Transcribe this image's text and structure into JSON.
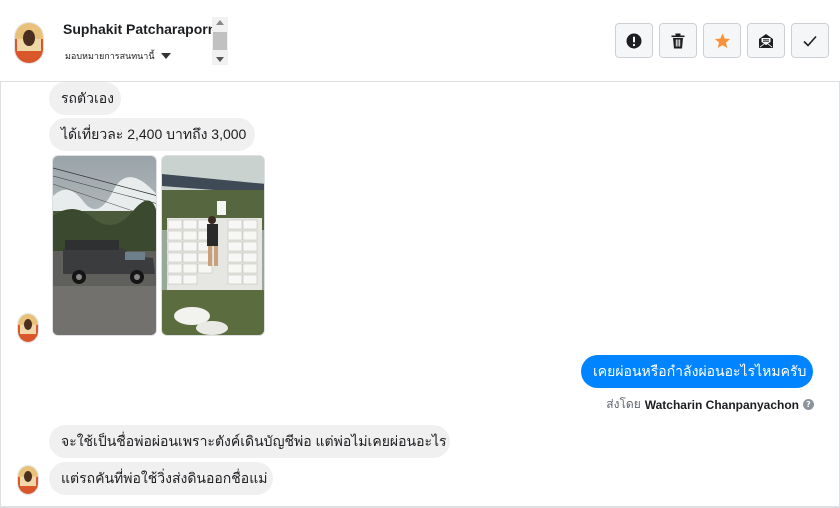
{
  "header": {
    "contact_name": "Suphakit Patcharaporn",
    "assign_label": "มอบหมายการสนทนานี้",
    "actions": [
      {
        "name": "report-spam-button",
        "icon": "exclamation-circle-icon"
      },
      {
        "name": "delete-button",
        "icon": "trash-icon"
      },
      {
        "name": "star-button",
        "icon": "star-icon",
        "color": "#f7923b"
      },
      {
        "name": "mark-unread-button",
        "icon": "envelope-icon"
      },
      {
        "name": "mark-done-button",
        "icon": "checkmark-icon"
      }
    ]
  },
  "messages": {
    "m1": "รถตัวเอง",
    "m2": "ได้เที่ยวละ 2,400 บาทถึง 3,000",
    "m3": "เคยผ่อนหรือกำลังผ่อนอะไรไหมครับ",
    "m4": "จะใช้เป็นชื่อพ่อผ่อนเพราะตังค์เดินบัญชีพ่อ แต่พ่อไม่เคยผ่อนอะไร",
    "m5": "แต่รถคันที่พ่อใช้วิ่งส่งดินออกชื่อแม่"
  },
  "sent_by": {
    "prefix": "ส่งโดย",
    "name": "Watcharin Chanpanyachon",
    "help": "?"
  },
  "photos": [
    {
      "name": "truck-photo",
      "subject": "pickup-truck"
    },
    {
      "name": "sacks-photo",
      "subject": "sacks-of-soil"
    }
  ],
  "colors": {
    "outgoing_bubble": "#0084ff",
    "incoming_bubble": "#f1f0f0",
    "star": "#f7923b"
  }
}
